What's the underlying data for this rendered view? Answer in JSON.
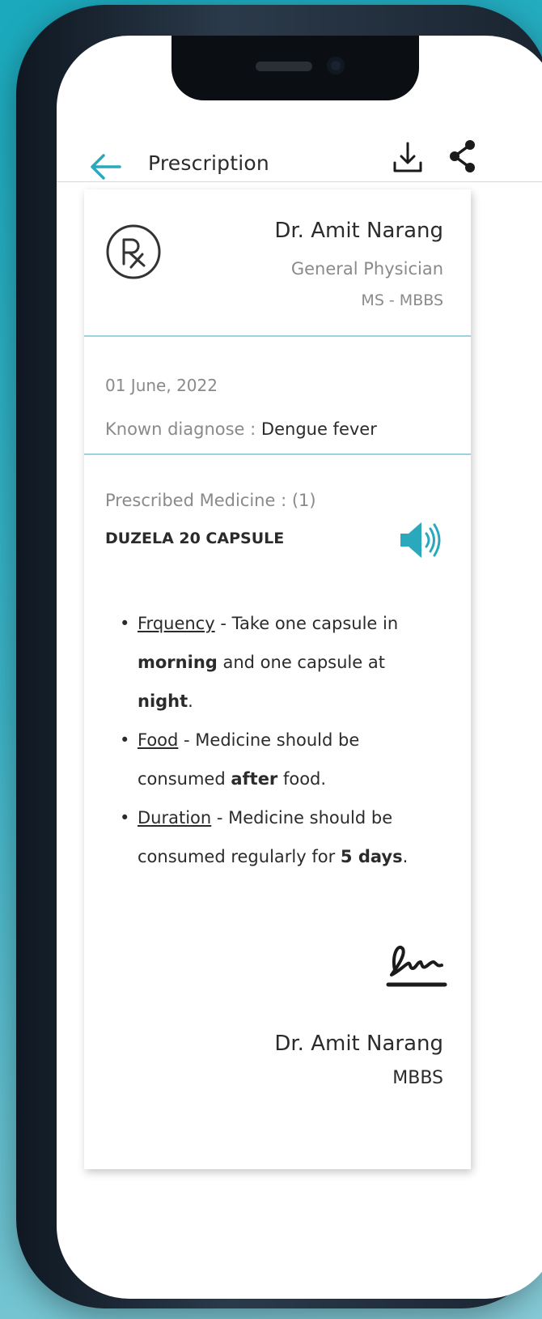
{
  "header": {
    "title": "Prescription",
    "back_icon": "arrow-left-icon",
    "download_icon": "download-icon",
    "share_icon": "share-icon"
  },
  "doctor": {
    "name": "Dr. Amit Narang",
    "specialty": "General Physician",
    "degree": "MS - MBBS",
    "logo_icon": "rx-icon"
  },
  "visit": {
    "date": "01 June, 2022",
    "diagnosis_label": "Known diagnose :",
    "diagnosis_value": "Dengue fever"
  },
  "medicine": {
    "prescribed_label": "Prescribed Medicine :",
    "prescribed_count": "(1)",
    "name": "DUZELA 20 CAPSULE",
    "audio_icon": "speaker-icon",
    "instructions": [
      {
        "label": "Frquency",
        "text_1": " - Take one capsule in ",
        "bold_1": "morning",
        "text_2": " and one capsule at ",
        "bold_2": "night",
        "text_3": "."
      },
      {
        "label": "Food",
        "text_1": " - Medicine should be consumed ",
        "bold_1": "after",
        "text_2": " food."
      },
      {
        "label": "Duration",
        "text_1": " - Medicine should be consumed regularly for ",
        "bold_1": "5 days",
        "text_2": "."
      }
    ]
  },
  "signature": {
    "name": "Dr. Amit Narang",
    "degree": "MBBS",
    "mark_icon": "signature-icon"
  },
  "colors": {
    "accent": "#2aa9bd",
    "text_primary": "#2b2b2b",
    "text_secondary": "#8a8a8a",
    "divider": "#9fd3dc"
  }
}
